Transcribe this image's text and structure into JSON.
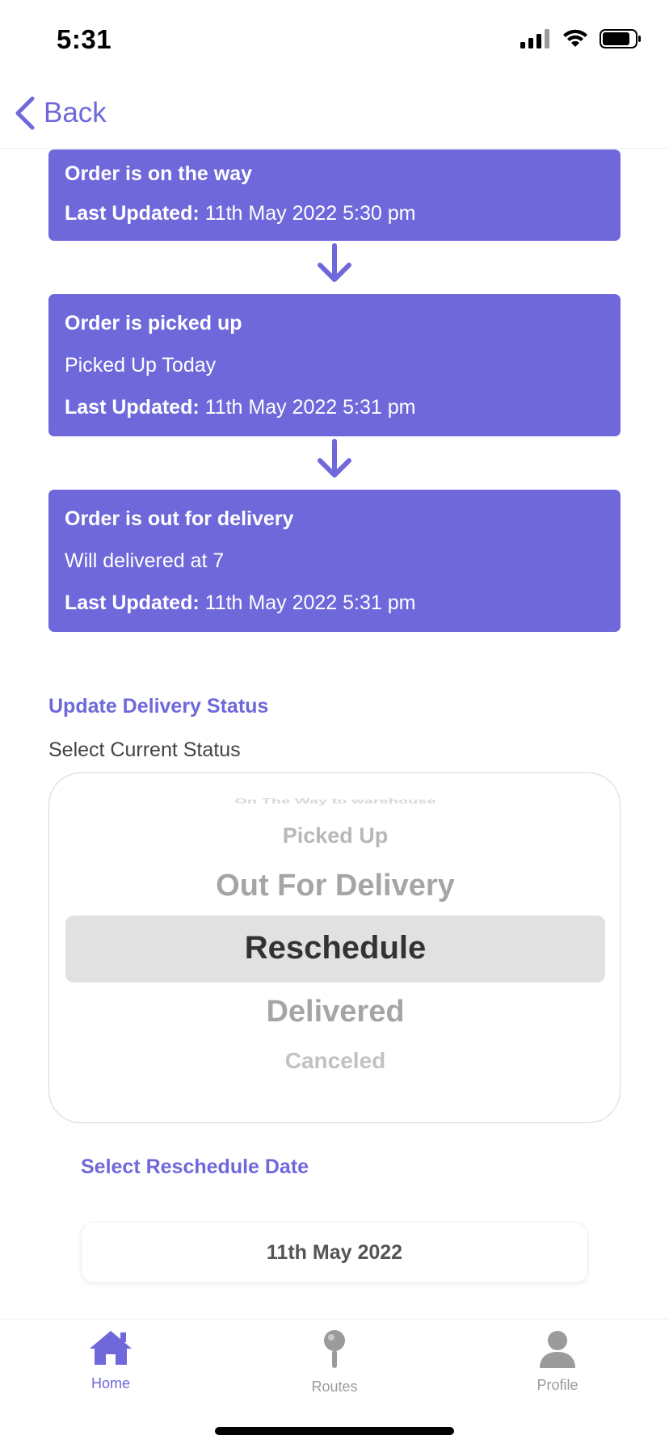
{
  "status_bar": {
    "time": "5:31"
  },
  "nav": {
    "back_label": "Back"
  },
  "timeline": [
    {
      "title": "Order is on the way",
      "note": "",
      "updated_label": "Last Updated:",
      "updated_value": "11th May 2022 5:30 pm"
    },
    {
      "title": "Order is picked up",
      "note": "Picked Up Today",
      "updated_label": "Last Updated:",
      "updated_value": "11th May 2022 5:31 pm"
    },
    {
      "title": "Order is out for delivery",
      "note": "Will delivered at 7",
      "updated_label": "Last Updated:",
      "updated_value": "11th May 2022 5:31 pm"
    }
  ],
  "update_section": {
    "title": "Update Delivery Status",
    "subtitle": "Select Current Status",
    "picker_options": [
      "On The Way to warehouse",
      "Picked Up",
      "Out For Delivery",
      "Reschedule",
      "Delivered",
      "Canceled"
    ],
    "selected": "Reschedule"
  },
  "reschedule": {
    "title": "Select Reschedule Date",
    "date": "11th May 2022"
  },
  "tabs": [
    {
      "label": "Home",
      "icon": "home-icon",
      "active": true
    },
    {
      "label": "Routes",
      "icon": "map-pin-icon",
      "active": false
    },
    {
      "label": "Profile",
      "icon": "person-icon",
      "active": false
    }
  ],
  "colors": {
    "accent": "#6F68DB",
    "inactive_tab": "#9b9b9b",
    "picker_highlight": "#e1e1e1"
  }
}
